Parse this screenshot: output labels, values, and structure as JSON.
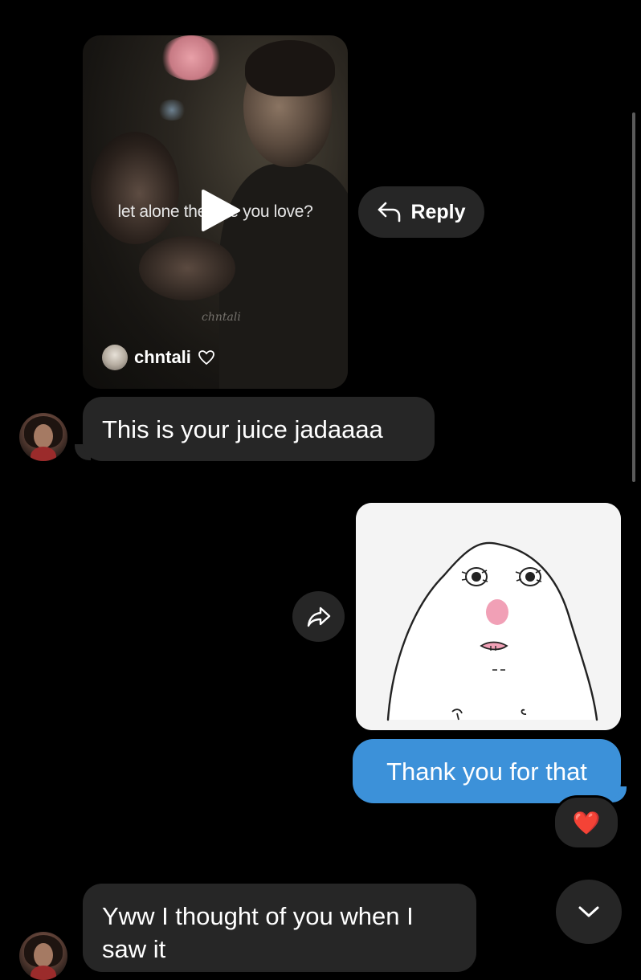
{
  "shared_video": {
    "caption": "let alone the one you love?",
    "creator": "chntali",
    "watermark": "chntali"
  },
  "reply_button": {
    "label": "Reply",
    "icon": "reply-arrow-icon"
  },
  "messages": [
    {
      "sender": "other",
      "text": "This is your juice jadaaaa"
    },
    {
      "sender": "me",
      "type": "sticker",
      "description_icon": "blob-sticker"
    },
    {
      "sender": "me",
      "text": "Thank you for that",
      "reaction": "❤️"
    },
    {
      "sender": "other",
      "text": "Yww I thought of you when I saw it"
    }
  ],
  "icons": {
    "play": "play-icon",
    "share": "share-icon",
    "scroll_down": "chevron-down-icon",
    "heart_outline": "heart-outline-icon"
  },
  "colors": {
    "background": "#000000",
    "incoming_bubble": "#262626",
    "outgoing_bubble": "#3c91d9",
    "text": "#ffffff"
  }
}
